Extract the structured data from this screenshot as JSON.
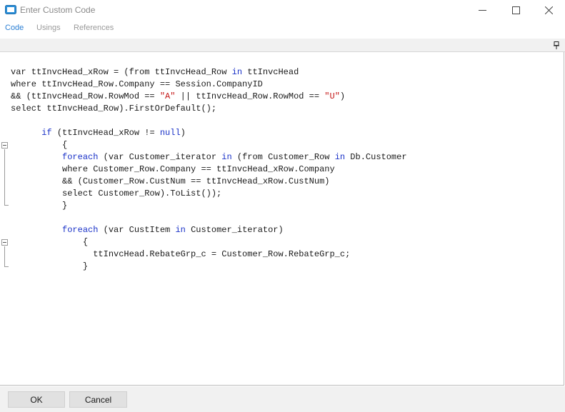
{
  "window": {
    "title": "Enter Custom Code",
    "icon": "window-app-icon",
    "controls": [
      "minimize-icon",
      "maximize-icon",
      "close-icon"
    ]
  },
  "tabs": [
    {
      "label": "Code",
      "active": true
    },
    {
      "label": "Usings",
      "active": false
    },
    {
      "label": "References",
      "active": false
    }
  ],
  "toolbar": {
    "pin_icon": "pin-icon"
  },
  "colors": {
    "keyword": "#1a32c8",
    "string": "#c41818",
    "active_tab": "#2b7fd4",
    "text": "#1a1a1a"
  },
  "code": {
    "lines": [
      [
        "var ttInvcHead_xRow = (from ttInvcHead_Row ",
        {
          "k": "in"
        },
        " ttInvcHead"
      ],
      [
        "where ttInvcHead_Row.Company == Session.CompanyID"
      ],
      [
        "&& (ttInvcHead_Row.RowMod == ",
        {
          "s": "\"A\""
        },
        " || ttInvcHead_Row.RowMod == ",
        {
          "s": "\"U\""
        },
        ")"
      ],
      [
        "select ttInvcHead_Row).FirstOrDefault();"
      ],
      [
        ""
      ],
      [
        "      ",
        {
          "k": "if"
        },
        " (ttInvcHead_xRow != ",
        {
          "k": "null"
        },
        ")"
      ],
      [
        "          {"
      ],
      [
        "          ",
        {
          "k": "foreach"
        },
        " (var Customer_iterator ",
        {
          "k": "in"
        },
        " (from Customer_Row ",
        {
          "k": "in"
        },
        " Db.Customer"
      ],
      [
        "          where Customer_Row.Company == ttInvcHead_xRow.Company"
      ],
      [
        "          && (Customer_Row.CustNum == ttInvcHead_xRow.CustNum)"
      ],
      [
        "          select Customer_Row).ToList());"
      ],
      [
        "          }"
      ],
      [
        ""
      ],
      [
        "          ",
        {
          "k": "foreach"
        },
        " (var CustItem ",
        {
          "k": "in"
        },
        " Customer_iterator)"
      ],
      [
        "              {"
      ],
      [
        "                ttInvcHead.RebateGrp_c = Customer_Row.RebateGrp_c;"
      ],
      [
        "              }"
      ]
    ]
  },
  "buttons": {
    "ok": "OK",
    "cancel": "Cancel"
  }
}
